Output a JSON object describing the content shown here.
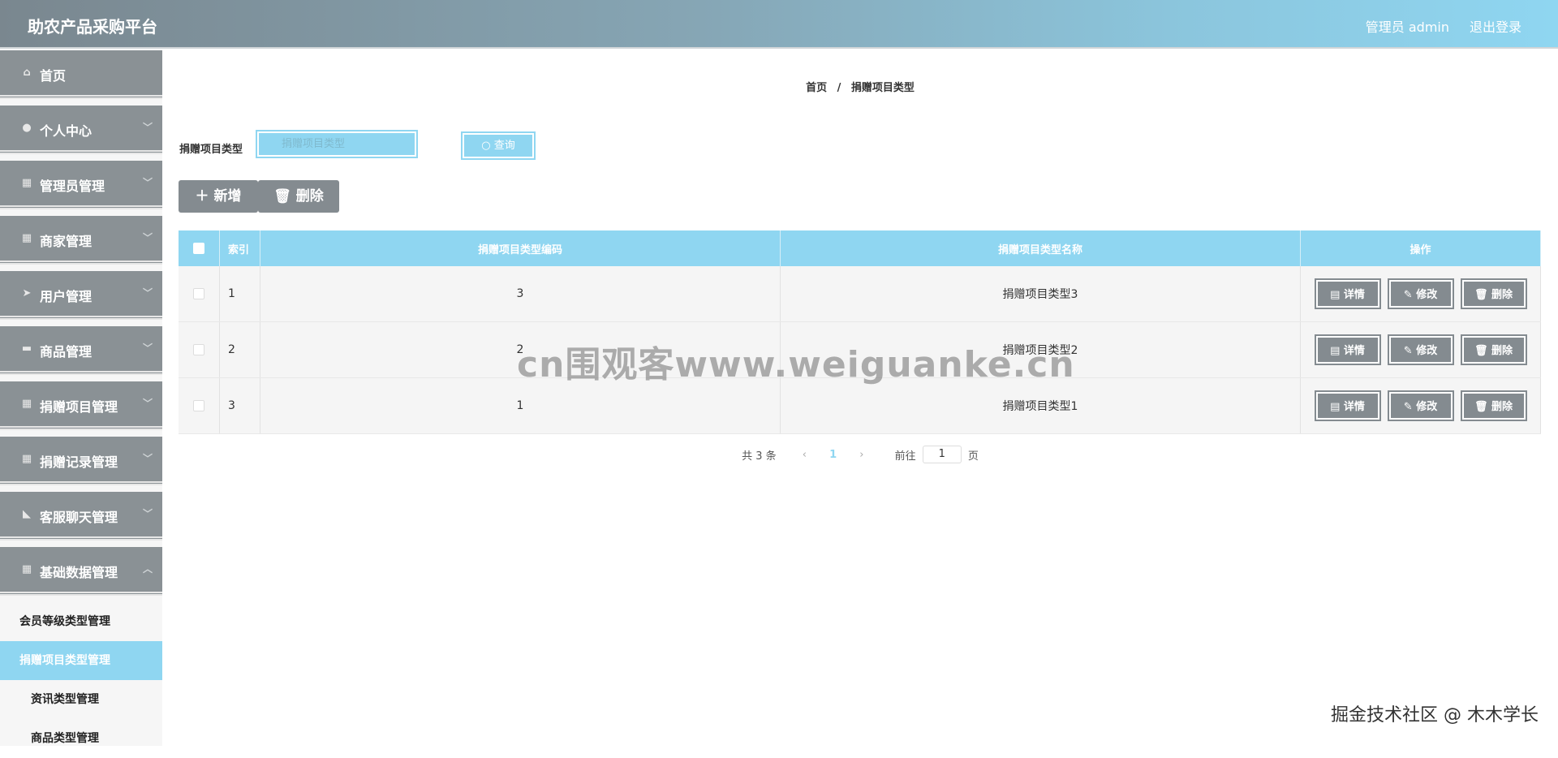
{
  "header": {
    "title": "助农产品采购平台",
    "admin": "管理员 admin",
    "logout": "退出登录"
  },
  "sidebar": {
    "items": [
      {
        "label": "首页",
        "icon": "home-icon",
        "glyph": "⌂",
        "chevron": ""
      },
      {
        "label": "个人中心",
        "icon": "user-icon",
        "glyph": "●",
        "chevron": "﹀"
      },
      {
        "label": "管理员管理",
        "icon": "grid-icon",
        "glyph": "▦",
        "chevron": "﹀"
      },
      {
        "label": "商家管理",
        "icon": "grid-icon",
        "glyph": "▦",
        "chevron": "﹀"
      },
      {
        "label": "用户管理",
        "icon": "send-icon",
        "glyph": "➤",
        "chevron": "﹀"
      },
      {
        "label": "商品管理",
        "icon": "chat-icon",
        "glyph": "▬",
        "chevron": "﹀"
      },
      {
        "label": "捐赠项目管理",
        "icon": "apps-icon",
        "glyph": "▦",
        "chevron": "﹀"
      },
      {
        "label": "捐赠记录管理",
        "icon": "grid-icon",
        "glyph": "▦",
        "chevron": "﹀"
      },
      {
        "label": "客服聊天管理",
        "icon": "thumb-icon",
        "glyph": "◣",
        "chevron": "﹀"
      },
      {
        "label": "基础数据管理",
        "icon": "grid-icon",
        "glyph": "▦",
        "chevron": "︿"
      }
    ],
    "sub_items": [
      "会员等级类型管理",
      "捐赠项目类型管理",
      "资讯类型管理",
      "商品类型管理"
    ]
  },
  "breadcrumb": {
    "home": "首页",
    "sep": "/",
    "current": "捐赠项目类型"
  },
  "search": {
    "label": "捐赠项目类型",
    "placeholder": "捐赠项目类型",
    "button": "查询"
  },
  "toolbar": {
    "add": "新增",
    "delete": "删除"
  },
  "table": {
    "headers": {
      "index": "索引",
      "code": "捐赠项目类型编码",
      "name": "捐赠项目类型名称",
      "ops": "操作"
    },
    "rows": [
      {
        "index": "1",
        "code": "3",
        "name": "捐赠项目类型3"
      },
      {
        "index": "2",
        "code": "2",
        "name": "捐赠项目类型2"
      },
      {
        "index": "3",
        "code": "1",
        "name": "捐赠项目类型1"
      }
    ],
    "ops": {
      "detail": "详情",
      "edit": "修改",
      "delete": "删除"
    }
  },
  "pagination": {
    "total": "共 3 条",
    "current_page": "1",
    "goto_label": "前往",
    "goto_value": "1",
    "page_suffix": "页"
  },
  "watermarks": {
    "center": "cn围观客www.weiguanke.cn",
    "corner": "掘金技术社区 @ 木木学长"
  },
  "colors": {
    "accent": "#8fd6f1",
    "sidebar": "#8a9195",
    "button": "#848b90"
  }
}
